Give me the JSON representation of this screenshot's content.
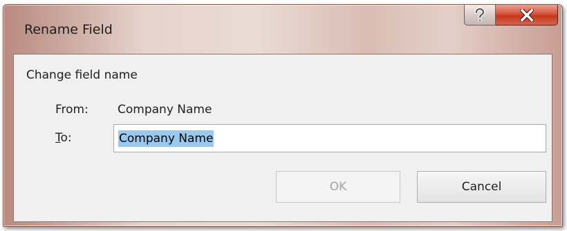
{
  "window": {
    "title": "Rename Field",
    "help_icon": "question-mark-icon",
    "close_icon": "close-x-icon",
    "close_button_color": "#c94a33"
  },
  "dialog": {
    "heading": "Change field name",
    "from_label": "From:",
    "from_value": "Company Name",
    "to_label_mnemonic": "T",
    "to_label_rest": "o:",
    "to_value": "Company Name",
    "selection_color": "#99c9ef"
  },
  "buttons": {
    "ok_label": "OK",
    "cancel_label": "Cancel"
  }
}
